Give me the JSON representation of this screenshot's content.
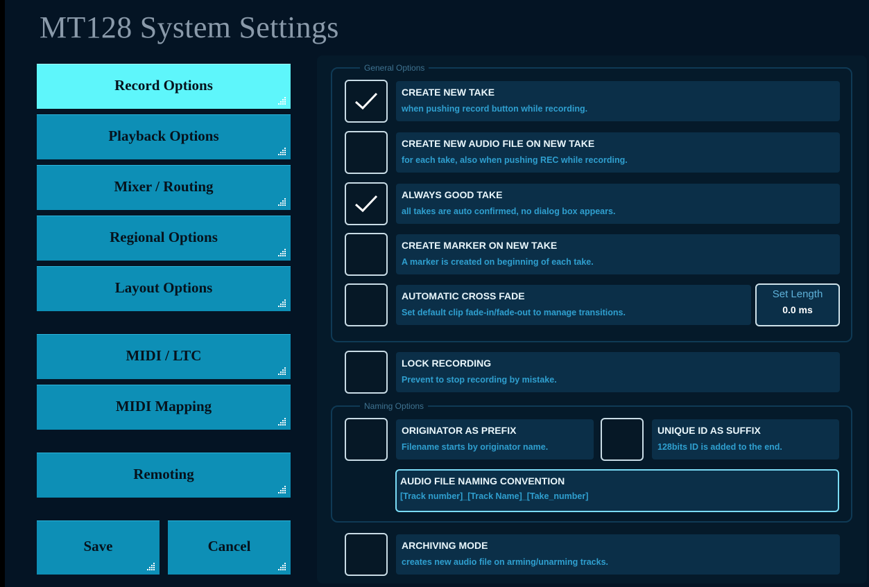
{
  "window": {
    "title": "MT128 System Settings"
  },
  "nav": {
    "record": "Record Options",
    "playback": "Playback Options",
    "mixer": "Mixer / Routing",
    "regional": "Regional Options",
    "layout": "Layout Options",
    "midi_ltc": "MIDI / LTC",
    "midi_mapping": "MIDI Mapping",
    "remoting": "Remoting",
    "save": "Save",
    "cancel": "Cancel",
    "active": "Record Options"
  },
  "general": {
    "legend": "General Options",
    "create_new_take": {
      "title": "CREATE NEW TAKE",
      "desc": "when pushing record button while recording.",
      "checked": true
    },
    "new_audio_file": {
      "title": "CREATE NEW AUDIO FILE ON NEW TAKE",
      "desc": "for each take, also when pushing REC while recording.",
      "checked": false
    },
    "always_good_take": {
      "title": "ALWAYS GOOD TAKE",
      "desc": "all takes are auto confirmed, no dialog box appears.",
      "checked": true
    },
    "marker_new_take": {
      "title": "CREATE MARKER ON NEW TAKE",
      "desc": "A marker is created on beginning of each take.",
      "checked": false
    },
    "cross_fade": {
      "title": "AUTOMATIC CROSS FADE",
      "desc": "Set default clip fade-in/fade-out to manage transitions.",
      "checked": false
    },
    "set_length": {
      "label": "Set Length",
      "value": "0.0 ms"
    }
  },
  "lock_recording": {
    "title": "LOCK RECORDING",
    "desc": "Prevent to stop recording by mistake.",
    "checked": false
  },
  "naming": {
    "legend": "Naming Options",
    "originator_prefix": {
      "title": "ORIGINATOR AS PREFIX",
      "desc": "Filename starts by originator name.",
      "checked": false
    },
    "unique_id_suffix": {
      "title": "UNIQUE ID AS SUFFIX",
      "desc": "128bits ID is added to the end.",
      "checked": false
    },
    "convention": {
      "title": "AUDIO FILE NAMING CONVENTION",
      "value": "[Track number]_[Track Name]_[Take_number]"
    }
  },
  "archiving": {
    "title": "ARCHIVING MODE",
    "desc": "creates new audio file on arming/unarming tracks.",
    "checked": false
  },
  "colors": {
    "accent": "#0d8fb6",
    "active": "#5ef6fb",
    "background": "#041424",
    "tile": "#0b2f48"
  },
  "icons": {
    "check": "check-icon",
    "grip": "resize-grip-icon"
  }
}
